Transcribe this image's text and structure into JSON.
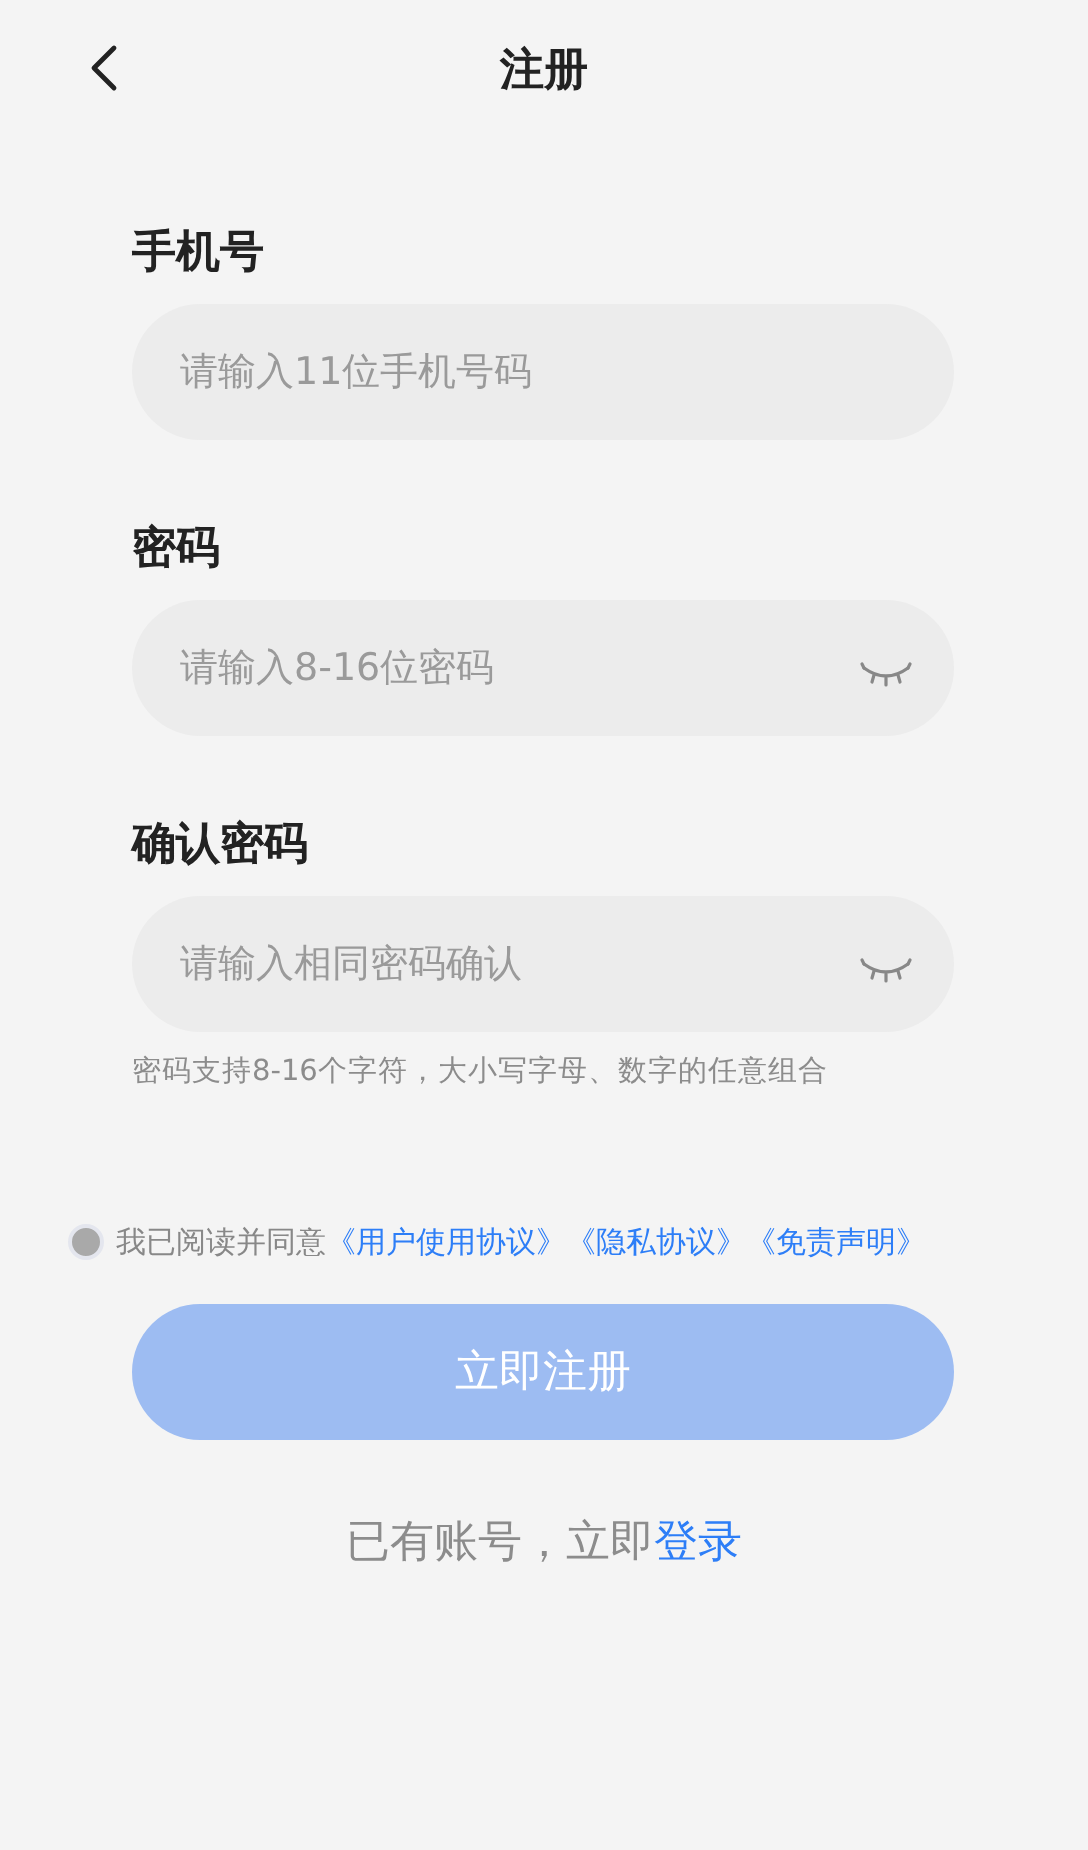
{
  "header": {
    "title": "注册"
  },
  "fields": [
    {
      "label": "手机号",
      "placeholder": "请输入11位手机号码",
      "kind": "text"
    },
    {
      "label": "密码",
      "placeholder": "请输入8-16位密码",
      "kind": "password",
      "show_password": false
    },
    {
      "label": "确认密码",
      "placeholder": "请输入相同密码确认",
      "kind": "password",
      "show_password": false
    }
  ],
  "hint": "密码支持8-16个字符，大小写字母、数字的任意组合",
  "agreement": {
    "checked": false,
    "text": "我已阅读并同意",
    "links": [
      "《用户使用协议》",
      "《隐私协议》",
      "《免责声明》"
    ]
  },
  "submit": {
    "label": "立即注册",
    "disabled": true
  },
  "footer": {
    "text": "已有账号，立即",
    "link": "登录"
  }
}
